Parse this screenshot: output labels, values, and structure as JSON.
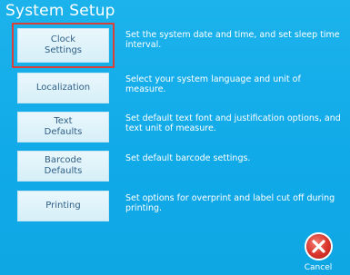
{
  "title": "System Setup",
  "items": [
    {
      "label": "Clock\nSettings",
      "description": "Set the system date and time, and set sleep time interval."
    },
    {
      "label": "Localization",
      "description": "Select your system language and unit of measure."
    },
    {
      "label": "Text\nDefaults",
      "description": "Set default text font and justification options, and text unit of measure."
    },
    {
      "label": "Barcode\nDefaults",
      "description": "Set default barcode settings."
    },
    {
      "label": "Printing",
      "description": "Set options for overprint and label cut off during printing."
    }
  ],
  "cancel": {
    "label": "Cancel",
    "icon": "cancel-x-icon"
  },
  "colors": {
    "background": "#12aeea",
    "button": "#e3f4fb",
    "button_text": "#2f5f86",
    "selection": "#d9403a",
    "cancel": "#d9332a"
  }
}
